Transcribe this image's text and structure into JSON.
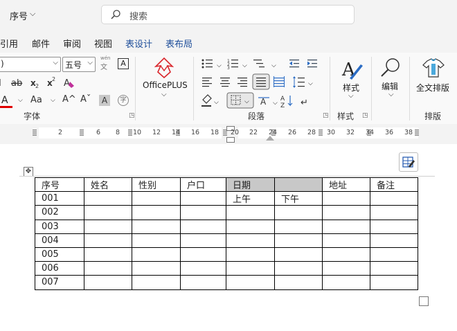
{
  "titlebar": {
    "doc_name": "序号",
    "search_placeholder": "搜索"
  },
  "tabs": [
    {
      "label": "引用"
    },
    {
      "label": "邮件"
    },
    {
      "label": "审阅"
    },
    {
      "label": "视图"
    },
    {
      "label": "表设计"
    },
    {
      "label": "表布局"
    }
  ],
  "ribbon": {
    "font_name": ")",
    "font_size": "五号",
    "phonetic_label": "wén",
    "phonetic_char": "文",
    "char_border_label": "A",
    "change_case_label": "Aa",
    "grow_font_label": "A^",
    "shrink_font_label": "Aˇ",
    "char_shading_label": "A",
    "enclose_label": "字",
    "officeplus_label": "OfficePLUS",
    "sort_az_top": "A",
    "sort_az_bottom": "Z",
    "styles_label": "样式",
    "editing_label": "编辑",
    "fulltext_label": "全文排版",
    "group_font": "字体",
    "group_paragraph": "段落",
    "group_styles": "样式",
    "group_layout": "排版",
    "colors": {
      "font_color_bar": "#e00000",
      "highlight": "#c8c8c8"
    }
  },
  "ruler": {
    "numbers": [
      "2",
      "6",
      "8",
      "10",
      "12",
      "14",
      "16",
      "18",
      "20",
      "22",
      "24",
      "26",
      "28",
      "30",
      "32",
      "34",
      "36",
      "38"
    ]
  },
  "table": {
    "rows": [
      [
        "序号",
        "姓名",
        "性别",
        "户口",
        "日期",
        "",
        "地址",
        "备注"
      ],
      [
        "001",
        "",
        "",
        "",
        "上午",
        "下午",
        "",
        ""
      ],
      [
        "002",
        "",
        "",
        "",
        "",
        "",
        "",
        ""
      ],
      [
        "003",
        "",
        "",
        "",
        "",
        "",
        "",
        ""
      ],
      [
        "004",
        "",
        "",
        "",
        "",
        "",
        "",
        ""
      ],
      [
        "005",
        "",
        "",
        "",
        "",
        "",
        "",
        ""
      ],
      [
        "006",
        "",
        "",
        "",
        "",
        "",
        "",
        ""
      ],
      [
        "007",
        "",
        "",
        "",
        "",
        "",
        "",
        ""
      ]
    ]
  }
}
